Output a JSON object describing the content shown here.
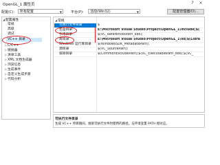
{
  "window": {
    "title": "OpenGL_1 属性页",
    "help": "?",
    "close": "×"
  },
  "toolbar": {
    "config_label": "配置(C):",
    "config_value": "所有配置",
    "platform_label": "平台(P):",
    "platform_value": "活动(Win32)",
    "config_manager_label": "配置管理器(O)..."
  },
  "tree": {
    "items": [
      {
        "label": "配置属性",
        "expanded": true
      },
      {
        "label": "常规"
      },
      {
        "label": "高级"
      },
      {
        "label": "调试"
      },
      {
        "label": "VC++ 目录",
        "selected": true
      },
      {
        "label": "C/C++",
        "expanded": false
      },
      {
        "label": "链接器",
        "expanded": false
      },
      {
        "label": "清单工具",
        "expanded": false
      },
      {
        "label": "XML 文档生成器",
        "expanded": false
      },
      {
        "label": "浏览信息",
        "expanded": false
      },
      {
        "label": "生成事件",
        "expanded": false
      },
      {
        "label": "自定义生成步骤",
        "expanded": false
      },
      {
        "label": "代码分析",
        "expanded": false
      }
    ]
  },
  "grid": {
    "group_label": "常规",
    "rows": [
      {
        "name": "可执行文件目录",
        "value": "$",
        "bold": false,
        "selected": true
      },
      {
        "name": "包含目录",
        "value": "E:\\Microsoft Visual Studio\\Project\\OpenGL_1\\include;$(",
        "bold": true
      },
      {
        "name": "引用目录",
        "value": "$(VC_ReferencesPath_x86);",
        "bold": false
      },
      {
        "name": "库目录",
        "value": "E:\\Microsoft Visual Studio\\Project\\OpenGL_1\\lib;$(Libra",
        "bold": true
      },
      {
        "name": "Windows 运行库目录",
        "value": "$(WindowsSDK_MetadataPath);",
        "bold": false
      },
      {
        "name": "源目录",
        "value": "$(VC_SourcePath);",
        "bold": false
      },
      {
        "name": "排除目录",
        "value": "$(CommonExcludePath);$(VC_ExecutablePath_x86);$(VC_",
        "bold": false
      }
    ]
  },
  "description": {
    "title": "可执行文件目录",
    "text": "生成 VC++ 项目期间，搜索可执行文件时使用的路径。与环境变量 PATH 相对应。"
  }
}
